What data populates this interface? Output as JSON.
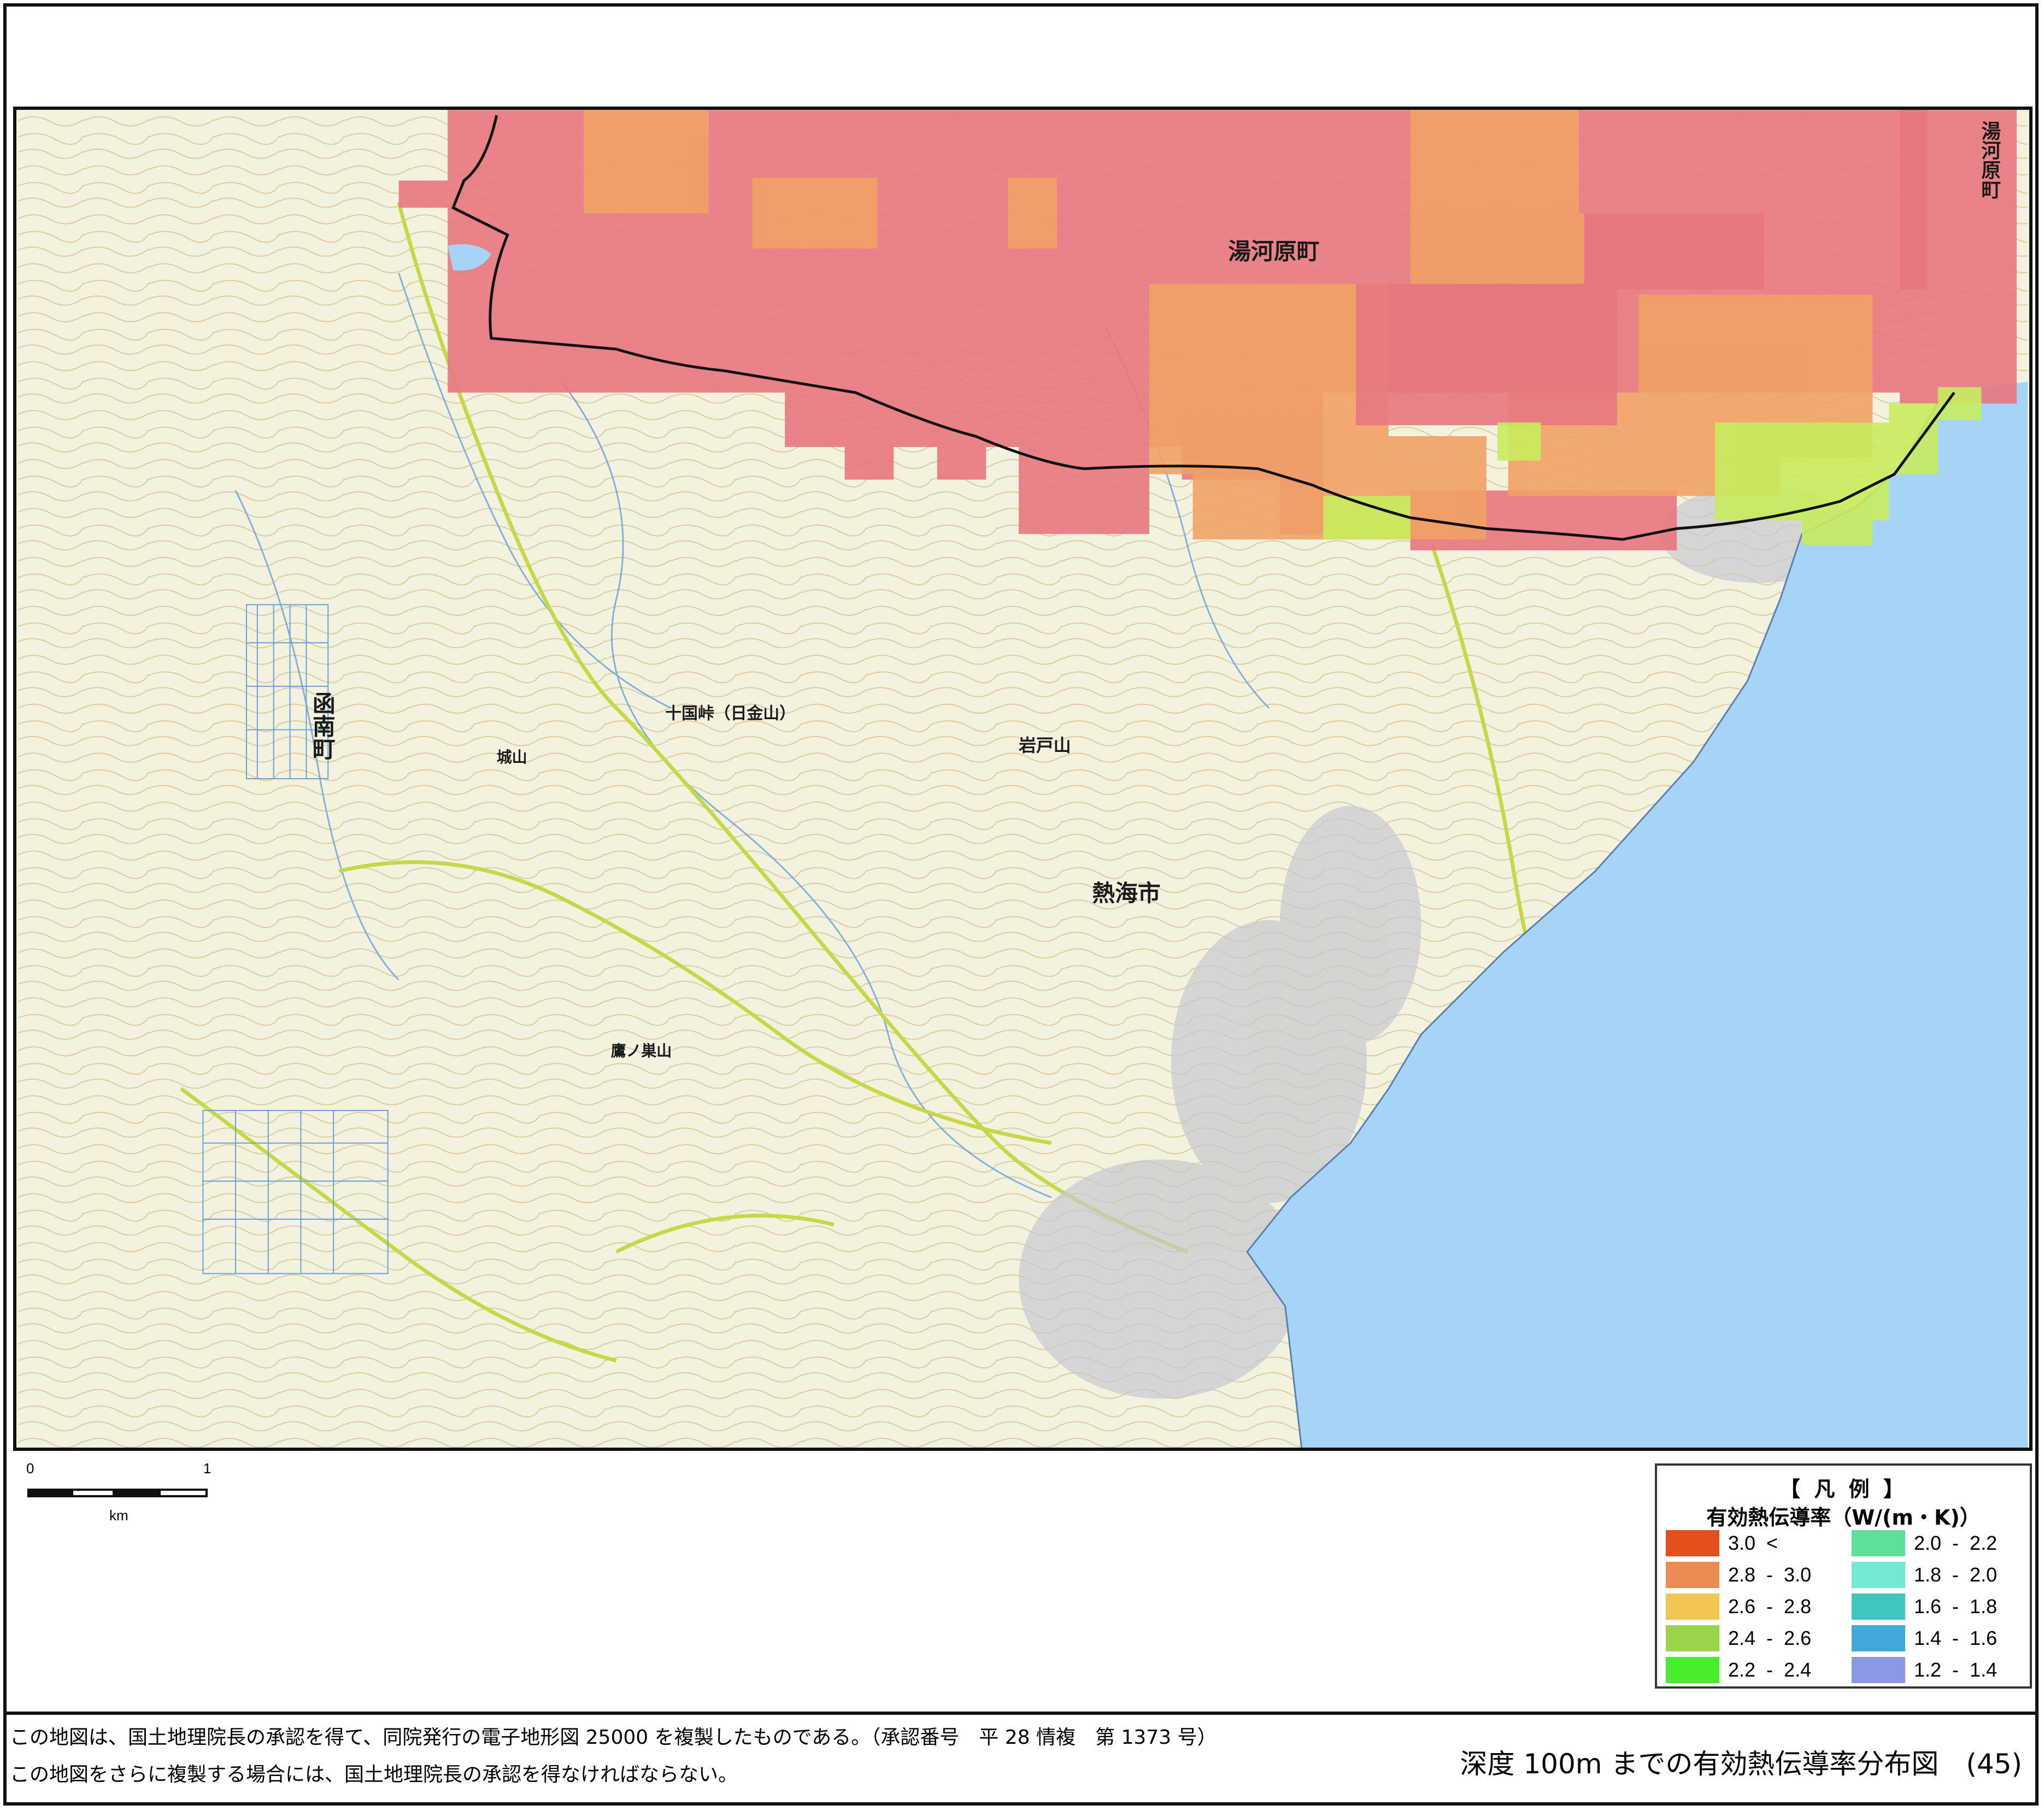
{
  "map": {
    "place_labels": {
      "yugawara": "湯河原町",
      "yugawara_corner": "湯河原町",
      "atami": "熱海市",
      "kannami": "函南町",
      "jukkoku": "十国峠（日金山）",
      "iwato": "岩戸山",
      "shiroyama": "城山",
      "kuranosuke": "鷹ノ巣山"
    },
    "water_color": "#a6d4f7",
    "land_color": "#f3f2df",
    "colors": {
      "pink_zone": "#e8777f",
      "orange_zone": "#f1a266",
      "green_zone": "#c8ec5e",
      "road": "#c3d947",
      "contour": "#d8c89a",
      "river": "#6aa0d8",
      "boundary": "#111111"
    }
  },
  "scale_bar": {
    "start": "0",
    "end": "1",
    "unit": "km"
  },
  "legend": {
    "title": "【 凡 例 】",
    "subtitle": "有効熱伝導率（W/(m・K)）",
    "entries": [
      {
        "label": "3.0  <",
        "color": "#e4501c"
      },
      {
        "label": "2.8  -  3.0",
        "color": "#ec8a54"
      },
      {
        "label": "2.6  -  2.8",
        "color": "#f2c653"
      },
      {
        "label": "2.4  -  2.6",
        "color": "#99d449"
      },
      {
        "label": "2.2  -  2.4",
        "color": "#4aed2e"
      },
      {
        "label": "2.0  -  2.2",
        "color": "#5ee09a"
      },
      {
        "label": "1.8  -  2.0",
        "color": "#74e9d1"
      },
      {
        "label": "1.6  -  1.8",
        "color": "#3dc7bf"
      },
      {
        "label": "1.4  -  1.6",
        "color": "#41a8dc"
      },
      {
        "label": "1.2  -  1.4",
        "color": "#8a98e6"
      }
    ]
  },
  "footer": {
    "line1": "この地図は、国土地理院長の承認を得て、同院発行の電子地形図 25000 を複製したものである。（承認番号　平 28 情複　第 1373 号）",
    "line2": "この地図をさらに複製する場合には、国土地理院長の承認を得なければならない。",
    "title": "深度 100m までの有効熱伝導率分布図　(45)"
  }
}
